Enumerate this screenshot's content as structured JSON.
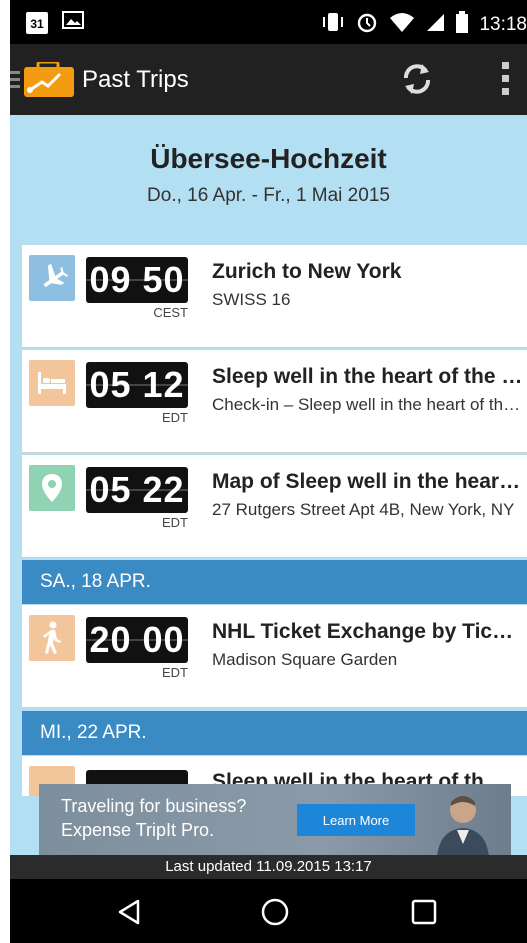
{
  "status_bar": {
    "calendar_day": "31",
    "time": "13:18"
  },
  "app_bar": {
    "title": "Past Trips",
    "icons": [
      "menu-drawer-icon",
      "tripit-logo-icon",
      "refresh-icon",
      "overflow-menu-icon"
    ]
  },
  "trip": {
    "title": "Übersee-Hochzeit",
    "dates": "Do., 16 Apr. - Fr., 1 Mai 2015"
  },
  "items": [
    {
      "icon": "airplane-icon",
      "icon_color": "#8fbfe0",
      "time": "09 50",
      "tz": "CEST",
      "title": "Zurich to New York",
      "subtitle": "SWISS 16"
    },
    {
      "icon": "bed-icon",
      "icon_color": "#f2c59a",
      "time": "05 12",
      "tz": "EDT",
      "title": "Sleep well in the heart of the Village",
      "subtitle": "Check-in – Sleep well in the heart of the Village"
    },
    {
      "icon": "map-pin-icon",
      "icon_color": "#8fd3b3",
      "time": "05 22",
      "tz": "EDT",
      "title": "Map of Sleep well in the heart of the Village",
      "subtitle": "27 Rutgers Street Apt 4B, New York, NY"
    }
  ],
  "day_headers": [
    "SA., 18 APR.",
    "MI., 22 APR."
  ],
  "items_day2": [
    {
      "icon": "walking-person-icon",
      "icon_color": "#f2c59a",
      "time": "20 00",
      "tz": "EDT",
      "title": "NHL Ticket Exchange by Ticketmaster",
      "subtitle": "Madison Square Garden"
    }
  ],
  "items_day3_partial": {
    "title": "Sleep well in the heart of th..."
  },
  "ad": {
    "line1": "Traveling for business?",
    "line2": "Expense TripIt Pro.",
    "button": "Learn More"
  },
  "footer": {
    "last_updated": "Last updated 11.09.2015 13:17"
  },
  "colors": {
    "content_bg": "#b3dff3",
    "day_header": "#3a8ac4",
    "app_bar": "#212121"
  }
}
